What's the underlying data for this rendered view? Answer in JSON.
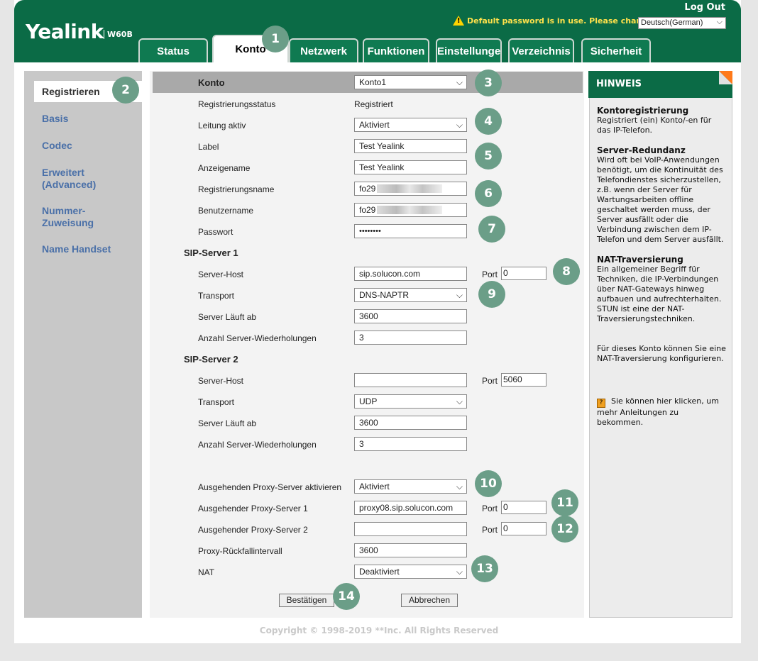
{
  "header": {
    "logo": "Yealink",
    "model": "W60B",
    "logout": "Log Out",
    "warning": "Default password is in use. Please change!",
    "language": "Deutsch(German)"
  },
  "tabs": [
    {
      "label": "Status"
    },
    {
      "label": "Konto"
    },
    {
      "label": "Netzwerk"
    },
    {
      "label": "Funktionen"
    },
    {
      "label": "Einstellungen"
    },
    {
      "label": "Verzeichnis"
    },
    {
      "label": "Sicherheit"
    }
  ],
  "sidebar": {
    "items": [
      {
        "label": "Registrieren"
      },
      {
        "label": "Basis"
      },
      {
        "label": "Codec"
      },
      {
        "label": "Erweitert\n(Advanced)"
      },
      {
        "label": "Nummer-\nZuweisung"
      },
      {
        "label": "Name Handset"
      }
    ]
  },
  "form": {
    "konto_label": "Konto",
    "konto_value": "Konto1",
    "reg_status_label": "Registrierungsstatus",
    "reg_status_value": "Registriert",
    "leitung_label": "Leitung aktiv",
    "leitung_value": "Aktiviert",
    "label_label": "Label",
    "label_value": "Test Yealink",
    "anzeigename_label": "Anzeigename",
    "anzeigename_value": "Test Yealink",
    "regname_label": "Registrierungsname",
    "regname_value": "fo29",
    "benutzer_label": "Benutzername",
    "benutzer_value": "fo29",
    "passwort_label": "Passwort",
    "passwort_value": "••••••••",
    "sip1_title": "SIP-Server 1",
    "sip1": {
      "host_label": "Server-Host",
      "host_value": "sip.solucon.com",
      "port_label": "Port",
      "port_value": "0",
      "transport_label": "Transport",
      "transport_value": "DNS-NAPTR",
      "expire_label": "Server Läuft ab",
      "expire_value": "3600",
      "retry_label": "Anzahl Server-Wiederholungen",
      "retry_value": "3"
    },
    "sip2_title": "SIP-Server 2",
    "sip2": {
      "host_label": "Server-Host",
      "host_value": "",
      "port_label": "Port",
      "port_value": "5060",
      "transport_label": "Transport",
      "transport_value": "UDP",
      "expire_label": "Server Läuft ab",
      "expire_value": "3600",
      "retry_label": "Anzahl Server-Wiederholungen",
      "retry_value": "3"
    },
    "proxy_enable_label": "Ausgehenden Proxy-Server aktivieren",
    "proxy_enable_value": "Aktiviert",
    "proxy1_label": "Ausgehender Proxy-Server 1",
    "proxy1_value": "proxy08.sip.solucon.com",
    "proxy1_port_label": "Port",
    "proxy1_port_value": "0",
    "proxy2_label": "Ausgehender Proxy-Server 2",
    "proxy2_value": "",
    "proxy2_port_label": "Port",
    "proxy2_port_value": "0",
    "fallback_label": "Proxy-Rückfallintervall",
    "fallback_value": "3600",
    "nat_label": "NAT",
    "nat_value": "Deaktiviert",
    "confirm_label": "Bestätigen",
    "cancel_label": "Abbrechen"
  },
  "hints": {
    "title": "HINWEIS",
    "h1_title": "Kontoregistrierung",
    "h1_text": "Registriert (ein) Konto/-en für das IP-Telefon.",
    "h2_title": "Server-Redundanz",
    "h2_text": "Wird oft bei VoIP-Anwendungen benötigt, um die Kontinuität des Telefondienstes sicherzustellen, z.B. wenn der Server für Wartungsarbeiten offline geschaltet werden muss, der Server ausfällt oder die Verbindung zwischen dem IP-Telefon und dem Server ausfällt.",
    "h3_title": "NAT-Traversierung",
    "h3_text": "Ein allgemeiner Begriff für Techniken, die IP-Verbindungen über NAT-Gateways hinweg aufbauen und aufrechterhalten. STUN ist eine der NAT-Traversierungstechniken.",
    "h4_text": "Für dieses Konto können Sie eine NAT-Traversierung konfigurieren.",
    "h5_text": "Sie können hier klicken, um mehr Anleitungen zu bekommen."
  },
  "badges": [
    "1",
    "2",
    "3",
    "4",
    "5",
    "6",
    "7",
    "8",
    "9",
    "10",
    "11",
    "12",
    "13",
    "14"
  ],
  "copyright": "Copyright © 1998-2019 **Inc. All Rights Reserved",
  "colors": {
    "brand_green": "#0b6b46",
    "badge": "#6b9e88",
    "link_blue": "#4a70a8",
    "warning": "#ffe14b"
  }
}
